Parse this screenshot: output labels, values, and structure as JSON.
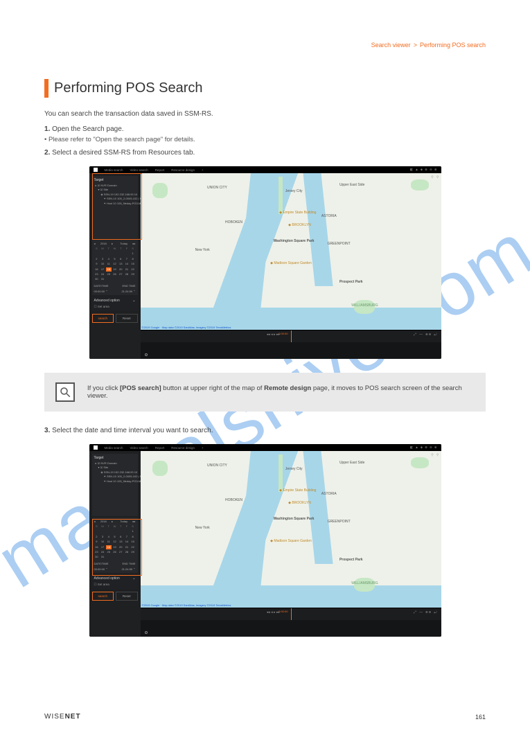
{
  "breadcrumb": [
    "Search viewer",
    "Performing POS search"
  ],
  "page_title": "Performing POS Search",
  "intro": "You can search the transaction data saved in SSM-RS.",
  "steps": [
    {
      "text": "Open the Search page.",
      "sub": [
        "Please refer to \"Open the search page\" for details."
      ]
    },
    {
      "text": "Select a desired SSM-RS from Resources tab."
    }
  ],
  "note_html_prefix": "If you click ",
  "note_button_ref": "[POS search]",
  "note_button_location": " button at upper right of the map of ",
  "note_button_page": "Remote design",
  "note_rest": " page, it moves to POS search screen of the search viewer.",
  "step3": "Select the date and time interval you want to search.",
  "screenshot": {
    "menubar": {
      "tabs": [
        "Media search",
        "Video search",
        "Report",
        "Resource design"
      ],
      "logo": "W."
    },
    "sidebar": {
      "target_header": "Target",
      "tree": [
        "NVR Domain",
        "Site",
        "SSN-19 192.232.168.93 10",
        "SSN-10 105_2-0005-102 | MG",
        "Host 10 105_fileday-PG3-MG"
      ],
      "calendar": {
        "month_label": "2018",
        "dow": [
          "Sun",
          "Mon",
          "Tue",
          "Wed",
          "Thu",
          "Fri",
          "Sat"
        ],
        "days_rows": [
          [
            "",
            "",
            "",
            "",
            "",
            "",
            "1"
          ],
          [
            "2",
            "3",
            "4",
            "5",
            "6",
            "7",
            "8"
          ],
          [
            "9",
            "10",
            "11",
            "12",
            "13",
            "14",
            "15"
          ],
          [
            "16",
            "17",
            "18",
            "19",
            "20",
            "21",
            "22"
          ],
          [
            "23",
            "24",
            "25",
            "26",
            "27",
            "28",
            "29"
          ],
          [
            "30",
            "31",
            "",
            "",
            "",
            "",
            ""
          ]
        ],
        "selected_day": "18",
        "date_label": "DATE/TIME",
        "end_label": "END TIME",
        "start_time": "00:00:00",
        "end_time": "21:24:59"
      },
      "advanced_header": "Advanced option",
      "advanced_item": "Set area",
      "buttons": {
        "search": "search",
        "reset": "Reset"
      }
    },
    "map": {
      "labels": [
        "UNION CITY",
        "HOBOKEN",
        "Jersey City",
        "New York",
        "Washington Square Park",
        "Madison Square Garden",
        "Empire State Building",
        "BROOKLYN",
        "Prospect Park",
        "WILLIAMSBURG",
        "GREENPOINT",
        "ASTORIA",
        "Upper East Side"
      ],
      "credits": "©2019 Google · Map data ©2019 SanAtlas; Imagery ©2019 TerraMetrics"
    },
    "timeline": {
      "time_display": "0:00:00"
    }
  },
  "footer": {
    "brand_left": "WISE",
    "brand_right": "NET",
    "page": "161"
  }
}
